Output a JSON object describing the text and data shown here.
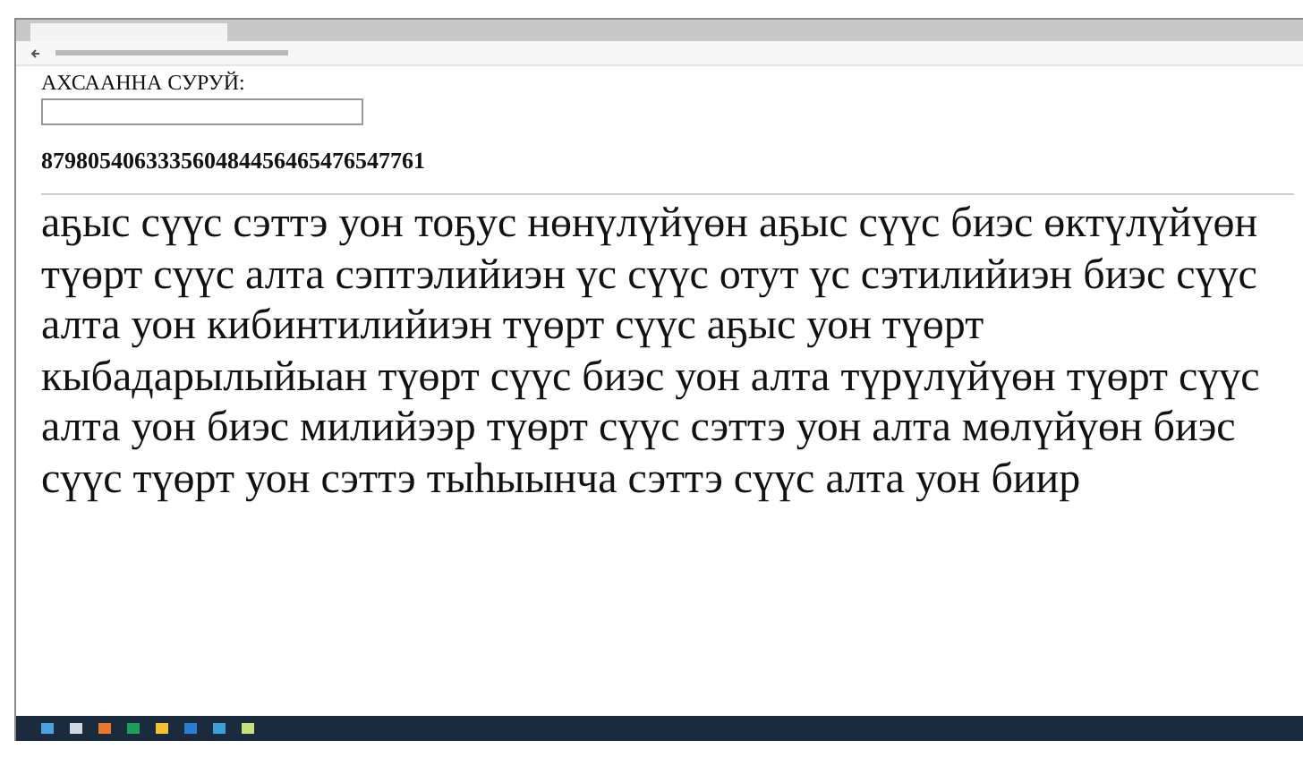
{
  "page": {
    "label": "АХСААННА СУРУЙ:",
    "number": "879805406333560484456465476547761",
    "text": "аҕыс сүүс сэттэ уон тоҕус нөнүлүйүөн аҕыс сүүс биэс өктүлүйүөн түөрт сүүс алта сэптэлийиэн үс сүүс отут үс сэтилийиэн биэс сүүс алта уон кибинтилийиэн түөрт сүүс аҕыс уон түөрт кыбадарылыйыан түөрт сүүс биэс уон алта түрүлүйүөн түөрт сүүс алта уон биэс милийээр түөрт сүүс сэттэ уон алта мөлүйүөн биэс сүүс түөрт уон сэттэ тыһыынча сэттэ сүүс алта уон биир"
  }
}
